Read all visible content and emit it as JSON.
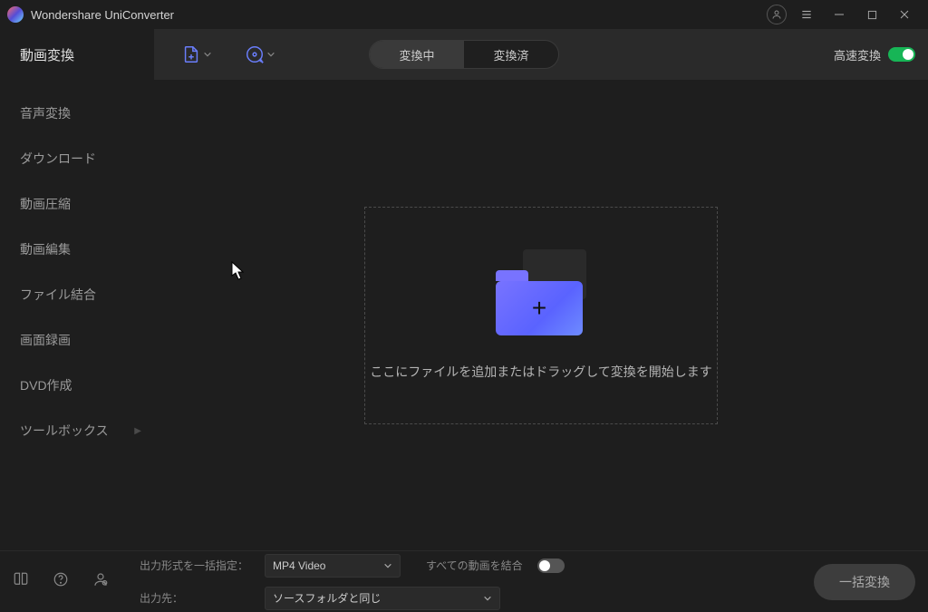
{
  "app": {
    "title": "Wondershare UniConverter"
  },
  "toolbar": {
    "active_tab": "動画変換",
    "seg_converting": "変換中",
    "seg_converted": "変換済",
    "fast_label": "高速変換"
  },
  "sidebar": {
    "items": [
      "音声変換",
      "ダウンロード",
      "動画圧縮",
      "動画編集",
      "ファイル結合",
      "画面録画",
      "DVD作成",
      "ツールボックス"
    ]
  },
  "dropzone": {
    "text": "ここにファイルを追加またはドラッグして変換を開始します"
  },
  "bottom": {
    "format_label": "出力形式を一括指定：",
    "format_value": "MP4 Video",
    "dest_label": "出力先：",
    "dest_value": "ソースフォルダと同じ",
    "merge_label": "すべての動画を結合",
    "convert": "一括変換"
  }
}
